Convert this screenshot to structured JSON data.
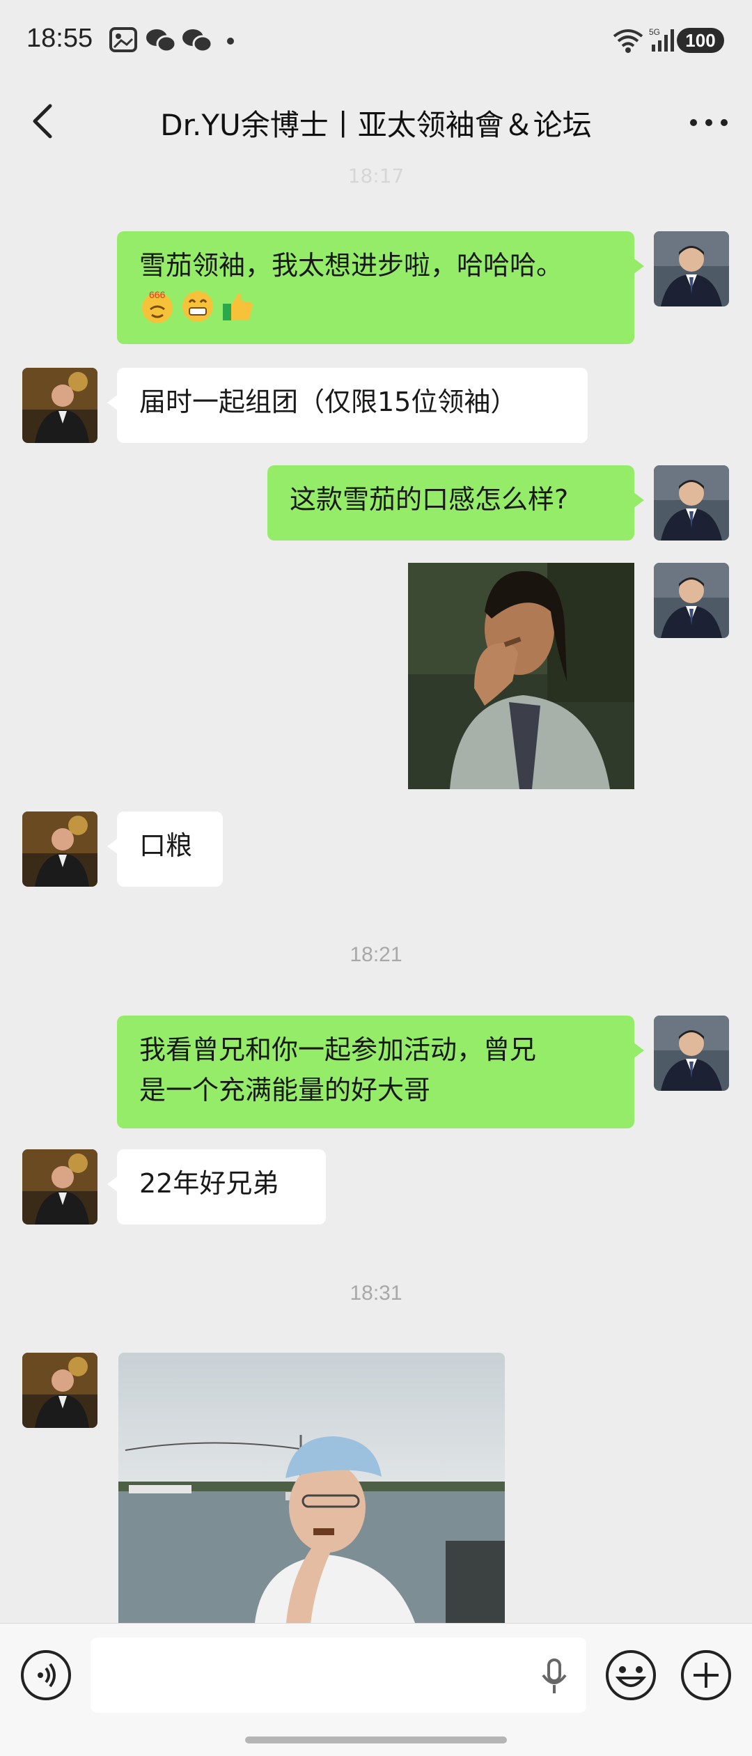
{
  "status_bar": {
    "time": "18:55",
    "network_label": "5G",
    "battery": "100"
  },
  "header": {
    "title": "Dr.YU余博士丨亚太领袖會＆论坛"
  },
  "chat": {
    "top_partial_time": "18:17",
    "messages": [
      {
        "sender": "me",
        "type": "text",
        "text": "雪茄领袖，我太想进步啦，哈哈哈。",
        "emojis": [
          "666-emoji",
          "grin-emoji",
          "thumbs-up-emoji"
        ]
      },
      {
        "sender": "them",
        "type": "text",
        "text": "届时一起组团（仅限15位领袖）"
      },
      {
        "sender": "me",
        "type": "text",
        "text": "这款雪茄的口感怎么样?"
      },
      {
        "sender": "me",
        "type": "image",
        "description": "man-smoking-sticker"
      },
      {
        "sender": "them",
        "type": "text",
        "text": "口粮"
      },
      {
        "sender": "me",
        "type": "text",
        "text": "我看曾兄和你一起参加活动，曾兄是一个充满能量的好大哥",
        "lines": [
          "我看曾兄和你一起参加活动，曾兄",
          "是一个充满能量的好大哥"
        ]
      },
      {
        "sender": "them",
        "type": "text",
        "text": "22年好兄弟"
      },
      {
        "sender": "them",
        "type": "image",
        "description": "man-with-cigar-by-water-photo"
      }
    ],
    "timestamps": [
      "18:21",
      "18:31"
    ]
  },
  "colors": {
    "background": "#ededed",
    "my_bubble": "#95ec69",
    "their_bubble": "#ffffff",
    "timestamp_text": "#a8a8a8"
  }
}
